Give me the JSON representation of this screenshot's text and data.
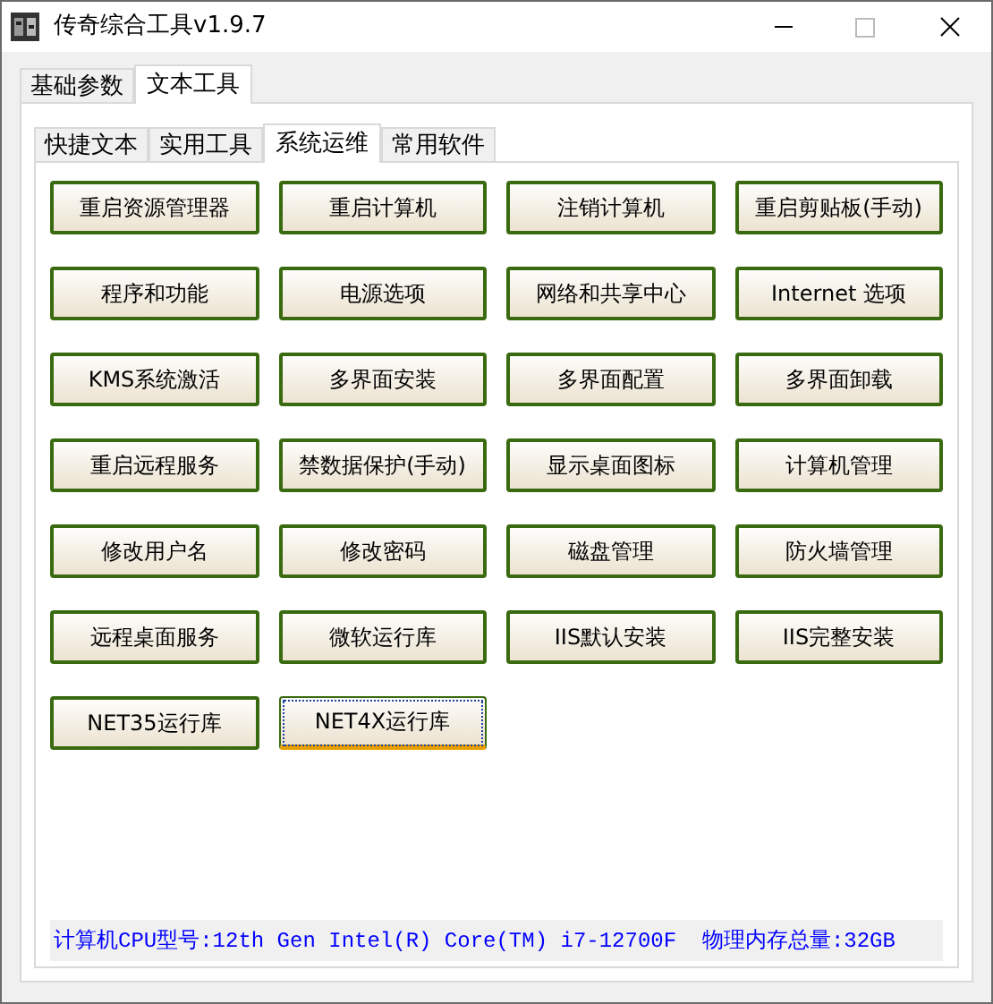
{
  "window": {
    "title": "传奇综合工具v1.9.7"
  },
  "tabs": [
    {
      "label": "基础参数",
      "selected": false
    },
    {
      "label": "文本工具",
      "selected": true
    }
  ],
  "subtabs": [
    {
      "label": "快捷文本",
      "selected": false
    },
    {
      "label": "实用工具",
      "selected": false
    },
    {
      "label": "系统运维",
      "selected": true
    },
    {
      "label": "常用软件",
      "selected": false
    }
  ],
  "buttons": [
    {
      "label": "重启资源管理器",
      "focused": false
    },
    {
      "label": "重启计算机",
      "focused": false
    },
    {
      "label": "注销计算机",
      "focused": false
    },
    {
      "label": "重启剪贴板(手动)",
      "focused": false
    },
    {
      "label": "程序和功能",
      "focused": false
    },
    {
      "label": "电源选项",
      "focused": false
    },
    {
      "label": "网络和共享中心",
      "focused": false
    },
    {
      "label": "Internet 选项",
      "focused": false
    },
    {
      "label": "KMS系统激活",
      "focused": false
    },
    {
      "label": "多界面安装",
      "focused": false
    },
    {
      "label": "多界面配置",
      "focused": false
    },
    {
      "label": "多界面卸载",
      "focused": false
    },
    {
      "label": "重启远程服务",
      "focused": false
    },
    {
      "label": "禁数据保护(手动)",
      "focused": false
    },
    {
      "label": "显示桌面图标",
      "focused": false
    },
    {
      "label": "计算机管理",
      "focused": false
    },
    {
      "label": "修改用户名",
      "focused": false
    },
    {
      "label": "修改密码",
      "focused": false
    },
    {
      "label": "磁盘管理",
      "focused": false
    },
    {
      "label": "防火墙管理",
      "focused": false
    },
    {
      "label": "远程桌面服务",
      "focused": false
    },
    {
      "label": "微软运行库",
      "focused": false
    },
    {
      "label": "IIS默认安装",
      "focused": false
    },
    {
      "label": "IIS完整安装",
      "focused": false
    },
    {
      "label": "NET35运行库",
      "focused": false
    },
    {
      "label": "NET4X运行库",
      "focused": true
    }
  ],
  "status_bar": "计算机CPU型号:12th Gen Intel(R) Core(TM) i7-12700F  物理内存总量:32GB"
}
